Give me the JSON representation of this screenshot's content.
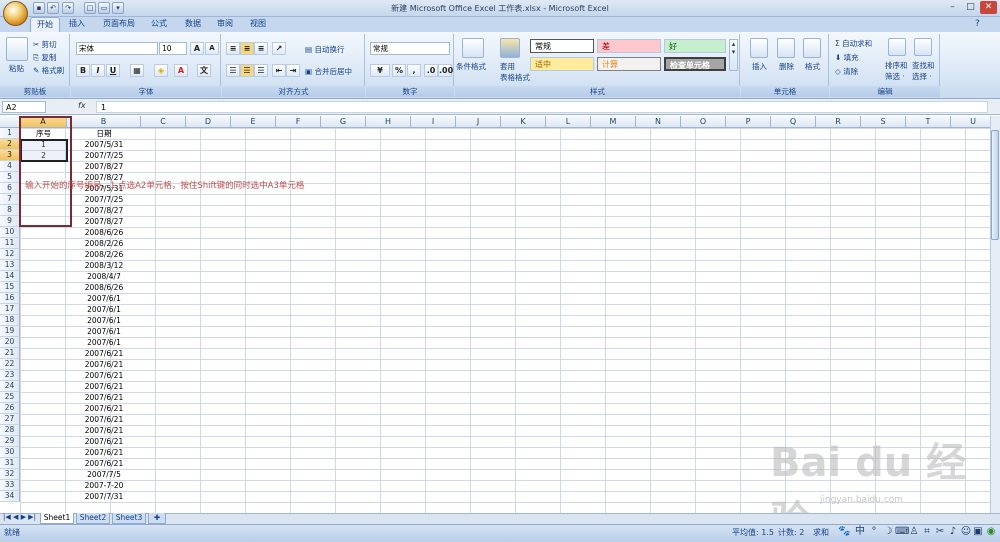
{
  "window": {
    "title": "新建 Microsoft Office Excel 工作表.xlsx - Microsoft Excel"
  },
  "ribbon_tabs": [
    "开始",
    "插入",
    "页面布局",
    "公式",
    "数据",
    "审阅",
    "视图"
  ],
  "ribbon": {
    "clipboard": {
      "paste": "粘贴",
      "cut": "剪切",
      "copy": "复制",
      "format_painter": "格式刷",
      "label": "剪贴板"
    },
    "font": {
      "name": "宋体",
      "size": "10",
      "label": "字体"
    },
    "alignment": {
      "wrap": "自动换行",
      "merge": "合并后居中",
      "label": "对齐方式"
    },
    "number": {
      "format": "常规",
      "label": "数字"
    },
    "styles": {
      "conditional": "条件格式",
      "table_format": "套用表格格式",
      "normal": "常规",
      "bad": "差",
      "good": "好",
      "neutral": "适中",
      "calculation": "计算",
      "check_cell": "检查单元格",
      "label": "样式"
    },
    "cells": {
      "insert": "插入",
      "delete": "删除",
      "format": "格式",
      "label": "单元格"
    },
    "editing": {
      "autosum": "自动求和",
      "fill": "填充",
      "clear": "清除",
      "sort": "排序和筛选",
      "find": "查找和选择",
      "label": "编辑"
    }
  },
  "formula_bar": {
    "name_box": "A2",
    "fx": "fx",
    "content": "1"
  },
  "columns": [
    "A",
    "B",
    "C",
    "D",
    "E",
    "F",
    "G",
    "H",
    "I",
    "J",
    "K",
    "L",
    "M",
    "N",
    "O",
    "P",
    "Q",
    "R",
    "S",
    "T",
    "U"
  ],
  "rows": [
    "1",
    "2",
    "3",
    "4",
    "5",
    "6",
    "7",
    "8",
    "9",
    "10",
    "11",
    "12",
    "13",
    "14",
    "15",
    "16",
    "17",
    "18",
    "19",
    "20",
    "21",
    "22",
    "23",
    "24",
    "25",
    "26",
    "27",
    "28",
    "29",
    "30",
    "31",
    "32",
    "33",
    "34"
  ],
  "header_row": {
    "a": "序号",
    "b": "日期"
  },
  "col_a_values": [
    "1",
    "2"
  ],
  "col_b_values": [
    "2007/5/31",
    "2007/7/25",
    "2007/8/27",
    "2007/8/27",
    "2007/5/31",
    "2007/7/25",
    "2007/8/27",
    "2007/8/27",
    "2008/6/26",
    "2008/2/26",
    "2008/2/26",
    "2008/3/12",
    "2008/4/7",
    "2008/6/26",
    "2007/6/1",
    "2007/6/1",
    "2007/6/1",
    "2007/6/1",
    "2007/6/1",
    "2007/6/21",
    "2007/6/21",
    "2007/6/21",
    "2007/6/21",
    "2007/6/21",
    "2007/6/21",
    "2007/6/21",
    "2007/6/21",
    "2007/6/21",
    "2007/6/21",
    "2007/6/21",
    "2007/7/5",
    "2007-7-20",
    "2007/7/31"
  ],
  "annotation": "输入开始的序号编号，1,点选A2单元格，按住Shift键的同时选中A3单元格",
  "sheet_tabs": [
    "Sheet1",
    "Sheet2",
    "Sheet3"
  ],
  "status": {
    "ready": "就绪",
    "average": "平均值: 1.5",
    "count": "计数: 2",
    "sum": "求和"
  },
  "watermark": {
    "brand": "Bai du 经验",
    "url": "jingyan.baidu.com"
  }
}
